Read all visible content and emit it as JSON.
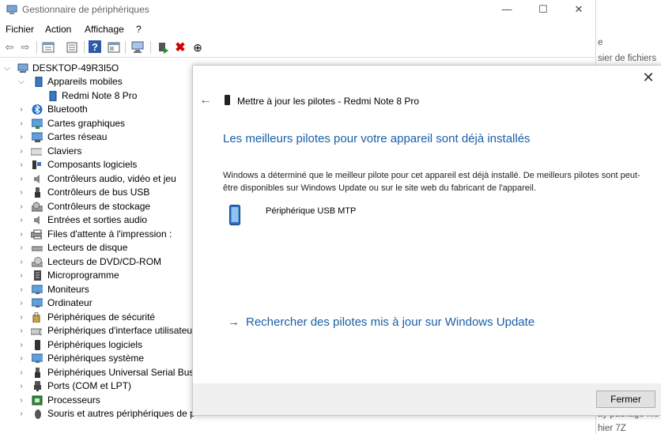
{
  "background_window": {
    "lines": [
      "e",
      "sier de fichiers",
      "ay package nie",
      "hier 7Z"
    ]
  },
  "window": {
    "title": "Gestionnaire de périphériques",
    "min_glyph": "—",
    "max_glyph": "☐",
    "close_glyph": "✕"
  },
  "menu": [
    "Fichier",
    "Action",
    "Affichage",
    "?"
  ],
  "toolbar": {
    "back": "⇦",
    "forward": "⇨",
    "help": "?",
    "remove": "✖",
    "download": "⊕"
  },
  "tree": {
    "root": "DESKTOP-49R3I5O",
    "items": [
      {
        "label": "Appareils mobiles",
        "expanded": true,
        "icon": "phone-icon"
      },
      {
        "label": "Redmi Note 8 Pro",
        "child": true,
        "icon": "phone-icon"
      },
      {
        "label": "Bluetooth",
        "icon": "bluetooth-icon"
      },
      {
        "label": "Cartes graphiques",
        "icon": "display-adapter-icon"
      },
      {
        "label": "Cartes réseau",
        "icon": "network-icon"
      },
      {
        "label": "Claviers",
        "icon": "keyboard-icon"
      },
      {
        "label": "Composants logiciels",
        "icon": "software-component-icon"
      },
      {
        "label": "Contrôleurs audio, vidéo et jeu",
        "icon": "speaker-icon"
      },
      {
        "label": "Contrôleurs de bus USB",
        "icon": "usb-icon"
      },
      {
        "label": "Contrôleurs de stockage",
        "icon": "storage-icon"
      },
      {
        "label": "Entrées et sorties audio",
        "icon": "speaker-icon"
      },
      {
        "label": "Files d'attente à l'impression :",
        "icon": "printer-icon"
      },
      {
        "label": "Lecteurs de disque",
        "icon": "disk-icon"
      },
      {
        "label": "Lecteurs de DVD/CD-ROM",
        "icon": "dvd-icon"
      },
      {
        "label": "Microprogramme",
        "icon": "firmware-icon"
      },
      {
        "label": "Moniteurs",
        "icon": "monitor-icon"
      },
      {
        "label": "Ordinateur",
        "icon": "monitor-icon"
      },
      {
        "label": "Périphériques de sécurité",
        "icon": "security-icon"
      },
      {
        "label": "Périphériques d'interface utilisateur",
        "icon": "hid-icon"
      },
      {
        "label": "Périphériques logiciels",
        "icon": "phone-icon"
      },
      {
        "label": "Périphériques système",
        "icon": "system-icon"
      },
      {
        "label": "Périphériques Universal Serial Bus",
        "icon": "usb-icon"
      },
      {
        "label": "Ports (COM et LPT)",
        "icon": "port-icon"
      },
      {
        "label": "Processeurs",
        "icon": "cpu-icon"
      },
      {
        "label": "Souris et autres périphériques de pointage",
        "icon": "mouse-icon"
      }
    ]
  },
  "dialog": {
    "header": "Mettre à jour les pilotes - Redmi Note 8 Pro",
    "heading": "Les meilleurs pilotes pour votre appareil sont déjà installés",
    "description": "Windows a déterminé que le meilleur pilote pour cet appareil est déjà installé. De meilleurs pilotes sont peut-être disponibles sur Windows Update ou sur le site web du fabricant de l'appareil.",
    "device": "Périphérique USB MTP",
    "link": "Rechercher des pilotes mis à jour sur Windows Update",
    "close_button": "Fermer",
    "close_glyph": "✕",
    "back_glyph": "←",
    "link_arrow": "→"
  },
  "colors": {
    "accent": "#1a5fa6",
    "remove_red": "#d40000",
    "update_green": "#1f8f2f"
  }
}
